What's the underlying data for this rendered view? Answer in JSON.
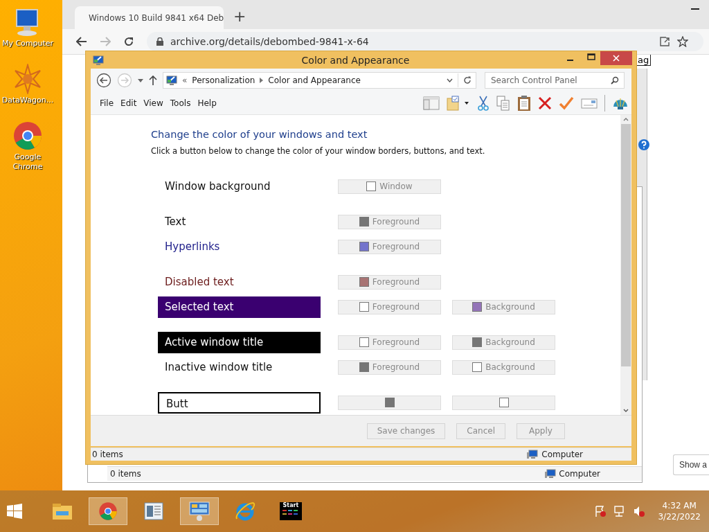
{
  "desktop": {
    "icons": [
      {
        "kind": "computer",
        "label": "My Computer"
      },
      {
        "kind": "star",
        "label": "DataWagon..."
      },
      {
        "kind": "chrome",
        "label": "Google Chrome"
      }
    ]
  },
  "browser": {
    "tab": {
      "title": "Windows 10 Build 9841 x64 Deb"
    },
    "new_tab": "+",
    "address": "archive.org/details/debombed-9841-x-64",
    "page": {
      "fragment": "ag",
      "show_button": "Show a",
      "back_window": {
        "items": "0 items",
        "location": "Computer"
      }
    }
  },
  "dialog": {
    "title": "Color and Appearance",
    "breadcrumb_prefix": "«",
    "breadcrumb": [
      "Personalization",
      "Color and Appearance"
    ],
    "search": {
      "placeholder": "Search Control Panel"
    },
    "menu": [
      "File",
      "Edit",
      "View",
      "Tools",
      "Help"
    ],
    "heading": "Change the color of your windows and text",
    "description": "Click a button below to change the color of your window borders, buttons, and text.",
    "rows": [
      {
        "label": "Window background",
        "kind": "plain",
        "buttons": [
          {
            "label": "Window",
            "color": "#ffffff"
          }
        ]
      },
      {
        "label": "Text",
        "kind": "plain",
        "buttons": [
          {
            "label": "Foreground",
            "color": "#767676"
          }
        ]
      },
      {
        "label": "Hyperlinks",
        "kind": "link",
        "buttons": [
          {
            "label": "Foreground",
            "color": "#7474cc"
          }
        ]
      },
      {
        "label": "Disabled text",
        "kind": "disabled",
        "buttons": [
          {
            "label": "Foreground",
            "color": "#a87474"
          }
        ]
      },
      {
        "label": "Selected text",
        "kind": "selected",
        "buttons": [
          {
            "label": "Foreground",
            "color": "#ffffff"
          },
          {
            "label": "Background",
            "color": "#9474b8"
          }
        ]
      },
      {
        "label": "Active window title",
        "kind": "active",
        "buttons": [
          {
            "label": "Foreground",
            "color": "#ffffff"
          },
          {
            "label": "Background",
            "color": "#767676"
          }
        ]
      },
      {
        "label": "Inactive window title",
        "kind": "plain",
        "buttons": [
          {
            "label": "Foreground",
            "color": "#767676"
          },
          {
            "label": "Background",
            "color": "#ffffff"
          }
        ]
      },
      {
        "label": "Butt",
        "kind": "outlined",
        "buttons": [
          {
            "color": "#767676"
          },
          {
            "color": "#ffffff"
          }
        ]
      }
    ],
    "footer_buttons": [
      {
        "label": "Save changes",
        "disabled": true
      },
      {
        "label": "Cancel",
        "disabled": true
      },
      {
        "label": "Apply",
        "disabled": true
      }
    ],
    "status": {
      "items": "0 items",
      "location": "Computer"
    }
  },
  "taskbar": {
    "apps": [
      {
        "kind": "explorer",
        "selected": false
      },
      {
        "kind": "chrome",
        "selected": true
      },
      {
        "kind": "document",
        "selected": false
      },
      {
        "kind": "control-panel",
        "selected": true
      },
      {
        "kind": "ie",
        "selected": false
      },
      {
        "kind": "start-app",
        "selected": false,
        "label": "Start"
      }
    ],
    "time": "4:32 AM",
    "date": "3/22/2022"
  }
}
